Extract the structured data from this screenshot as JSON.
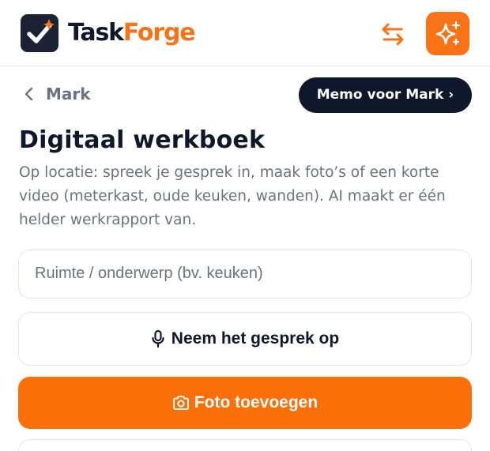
{
  "header": {
    "brand_part1": "Task",
    "brand_part2": "Forge",
    "icons": [
      "check-logo-icon",
      "swap-arrows-icon",
      "sparkles-icon"
    ]
  },
  "nav": {
    "back_label": "Mark",
    "memo_button": "Memo voor Mark ›"
  },
  "main": {
    "title": "Digitaal werkboek",
    "description": "Op locatie: spreek je gesprek in, maak foto’s of een korte video (meterkast, oude keuken, wanden). AI maakt er één helder werkrapport van.",
    "room_input": {
      "placeholder": "Ruimte / onderwerp (bv. keuken)",
      "value": ""
    },
    "record_button": "Neem het gesprek op",
    "photo_button": "Foto toevoegen"
  },
  "colors": {
    "accent": "#f97316",
    "dark": "#0f172a",
    "muted": "#6b7280",
    "border": "#ece5d8"
  }
}
